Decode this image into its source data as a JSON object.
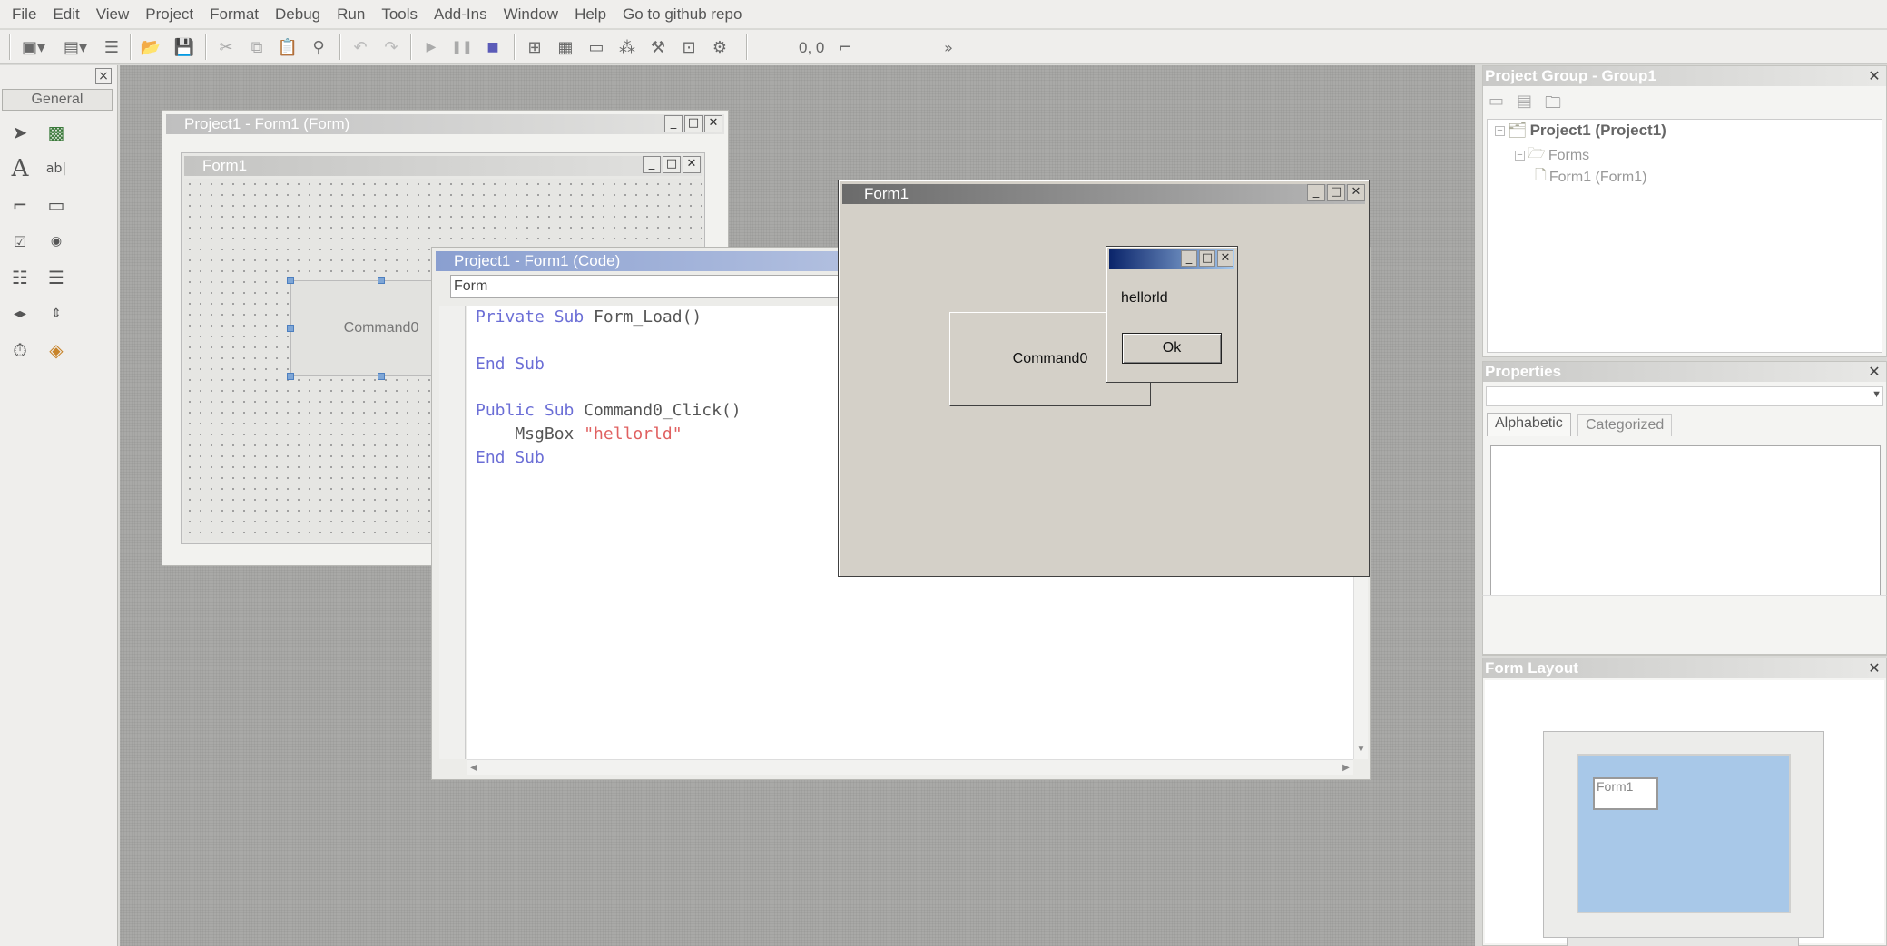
{
  "menu": [
    "File",
    "Edit",
    "View",
    "Project",
    "Format",
    "Debug",
    "Run",
    "Tools",
    "Add-Ins",
    "Window",
    "Help",
    "Go to github repo"
  ],
  "toolbar": {
    "coords": "0, 0",
    "overflow": "»"
  },
  "toolbox": {
    "tab": "General"
  },
  "designer": {
    "title": "Project1 - Form1 (Form)",
    "inner_title": "Form1",
    "button_label": "Command0"
  },
  "code_window": {
    "title": "Project1 - Form1 (Code)",
    "object_combo": "Form",
    "lines": [
      [
        {
          "t": "Private Sub ",
          "c": "kw"
        },
        {
          "t": "Form_Load()",
          "c": ""
        }
      ],
      [],
      [
        {
          "t": "End Sub",
          "c": "kw"
        }
      ],
      [],
      [
        {
          "t": "Public Sub ",
          "c": "kw"
        },
        {
          "t": "Command0_Click()",
          "c": ""
        }
      ],
      [
        {
          "t": "    MsgBox ",
          "c": ""
        },
        {
          "t": "\"hellorld\"",
          "c": "str"
        }
      ],
      [
        {
          "t": "End Sub",
          "c": "kw"
        }
      ]
    ]
  },
  "run_form": {
    "title": "Form1",
    "button_label": "Command0"
  },
  "msgbox": {
    "message": "hellorld",
    "ok_label": "Ok"
  },
  "project_group": {
    "title": "Project Group - Group1",
    "tree": [
      {
        "label": "Project1 (Project1)",
        "level": 0
      },
      {
        "label": "Forms",
        "level": 1
      },
      {
        "label": "Form1 (Form1)",
        "level": 2
      }
    ]
  },
  "properties": {
    "title": "Properties",
    "tabs": [
      "Alphabetic",
      "Categorized"
    ],
    "selected_object": ""
  },
  "form_layout": {
    "title": "Form Layout",
    "form_label": "Form1"
  },
  "colors": {
    "msgbox_title_start": "#0a246a",
    "msgbox_title_end": "#a6caf0",
    "layout_screen": "#a8c8e8"
  }
}
